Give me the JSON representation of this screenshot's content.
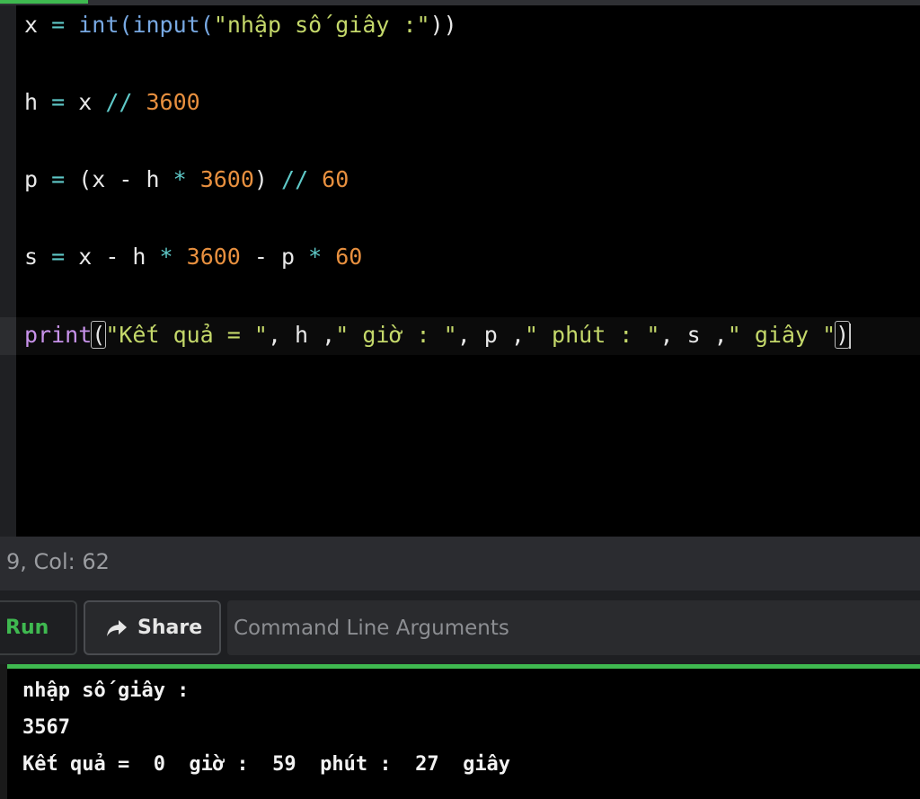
{
  "code": {
    "line1": {
      "var": "x",
      "eq": " = ",
      "fn_int": "int",
      "p1": "(",
      "fn_input": "input",
      "p2": "(",
      "prompt": "\"nhập số giây :\"",
      "close": "))"
    },
    "line2": {
      "var": "h",
      "eq": " = ",
      "x": "x ",
      "op": "//",
      "num": " 3600"
    },
    "line3": {
      "var": "p",
      "eq": " = ",
      "paren": "(x - h ",
      "star": "*",
      "num1": " 3600",
      "close": ") ",
      "op": "//",
      "num2": " 60"
    },
    "line4": {
      "var": "s",
      "eq": " = ",
      "a": "x - h ",
      "star1": "*",
      "num1": " 3600",
      "b": " - p ",
      "star2": "*",
      "num2": " 60"
    },
    "line5": {
      "fn": "print",
      "open": "(",
      "s1": "\"Kết quả = \"",
      "a1": ", h ,",
      "s2": "\" giờ : \"",
      "a2": ", p ,",
      "s3": "\" phút : \"",
      "a3": ", s ,",
      "s4": "\" giây \"",
      "close": ")"
    }
  },
  "status": {
    "position": "9, Col: 62"
  },
  "toolbar": {
    "run_label": "Run",
    "share_label": "Share",
    "args_placeholder": "Command Line Arguments"
  },
  "console": {
    "lines": [
      "nhập số giây :",
      "3567",
      "Kết quả =  0  giờ :  59  phút :  27  giây"
    ]
  },
  "colors": {
    "accent": "#3fb950",
    "function": "#78a9e3",
    "keyword": "#c792ea",
    "string": "#c4d86a",
    "number": "#e8903f",
    "operator": "#5fc9c8"
  },
  "icons": {
    "share": "share-arrow-icon"
  }
}
